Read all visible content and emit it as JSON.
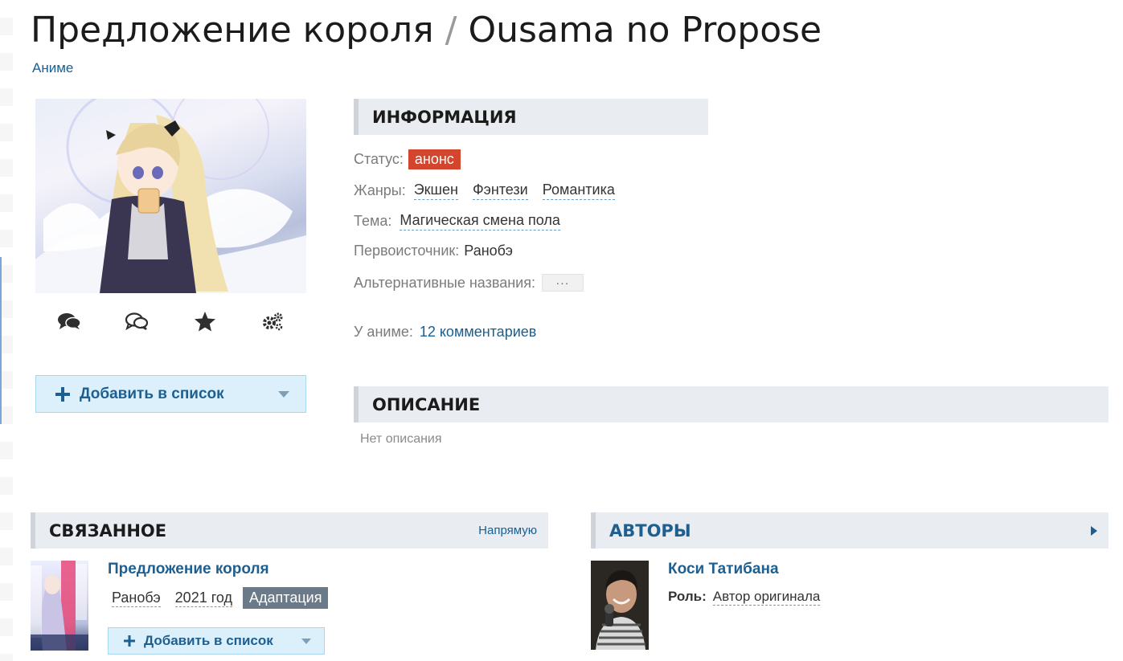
{
  "header": {
    "title_ru": "Предложение короля",
    "separator": "/",
    "title_romaji": "Ousama no Propose",
    "breadcrumb": "Аниме"
  },
  "icons": {
    "poster_actions": [
      "comments-icon",
      "discussion-icon",
      "star-icon",
      "gears-icon"
    ],
    "add": "plus-icon",
    "caret": "chevron-down-icon",
    "more": "chevron-right-icon"
  },
  "add_to_list": {
    "label": "Добавить в список"
  },
  "info": {
    "heading": "ИНФОРМАЦИЯ",
    "status_label": "Статус:",
    "status_value": "анонс",
    "genres_label": "Жанры:",
    "genres": [
      "Экшен",
      "Фэнтези",
      "Романтика"
    ],
    "theme_label": "Тема:",
    "theme_value": "Магическая смена пола",
    "source_label": "Первоисточник:",
    "source_value": "Ранобэ",
    "alt_names_label": "Альтернативные названия:",
    "alt_names_button": "···",
    "comments_label": "У аниме:",
    "comments_link": "12 комментариев"
  },
  "description": {
    "heading": "ОПИСАНИЕ",
    "text": "Нет описания"
  },
  "related": {
    "heading": "СВЯЗАННОЕ",
    "filter_link": "Напрямую",
    "item": {
      "title": "Предложение короля",
      "kind": "Ранобэ",
      "year": "2021 год",
      "relation": "Адаптация",
      "add_label": "Добавить в список"
    }
  },
  "authors": {
    "heading": "АВТОРЫ",
    "item": {
      "name": "Коси Татибана",
      "role_label": "Роль:",
      "role_value": "Автор оригинала"
    }
  },
  "colors": {
    "accent": "#176093",
    "status_badge": "#d3452d",
    "relation_badge": "#6b7a88",
    "button_bg": "#dcf0fc"
  }
}
